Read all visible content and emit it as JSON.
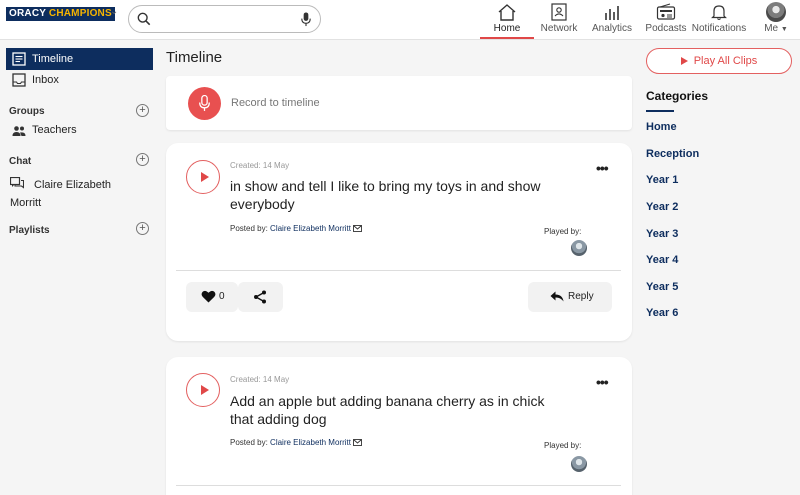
{
  "header": {
    "logo_part1": "ORACY",
    "logo_part2": "CHAMPIONS",
    "search": {
      "value": "",
      "placeholder": ""
    },
    "nav": [
      {
        "label": "Home",
        "icon": "home-icon"
      },
      {
        "label": "Network",
        "icon": "network-icon"
      },
      {
        "label": "Analytics",
        "icon": "analytics-icon"
      },
      {
        "label": "Podcasts",
        "icon": "radio-icon"
      },
      {
        "label": "Notifications",
        "icon": "bell-icon"
      },
      {
        "label": "Me",
        "icon": "avatar"
      }
    ],
    "active_nav": "Home",
    "accent_color": "#e04848",
    "brand_color": "#0d2d5e"
  },
  "sidebar": {
    "timeline": "Timeline",
    "inbox": "Inbox",
    "groups_heading": "Groups",
    "groups": [
      "Teachers"
    ],
    "chat_heading": "Chat",
    "chats": [
      "Claire Elizabeth Morritt"
    ],
    "playlists_heading": "Playlists"
  },
  "main": {
    "title": "Timeline",
    "record_label": "Record to timeline",
    "clips": [
      {
        "created": "Created: 14 May",
        "text": "in show and tell I like to bring my toys in and show everybody",
        "posted_by_label": "Posted by:",
        "author": "Claire Elizabeth Morritt",
        "played_by_label": "Played by:",
        "likes": "0",
        "reply_label": "Reply"
      },
      {
        "created": "Created: 14 May",
        "text": "Add an apple but adding banana cherry as in chick that adding dog",
        "posted_by_label": "Posted by:",
        "author": "Claire Elizabeth Morritt",
        "played_by_label": "Played by:"
      }
    ]
  },
  "right_panel": {
    "play_all": "Play All Clips",
    "categories_title": "Categories",
    "categories": [
      "Home",
      "Reception",
      "Year 1",
      "Year 2",
      "Year 3",
      "Year 4",
      "Year 5",
      "Year 6"
    ]
  }
}
